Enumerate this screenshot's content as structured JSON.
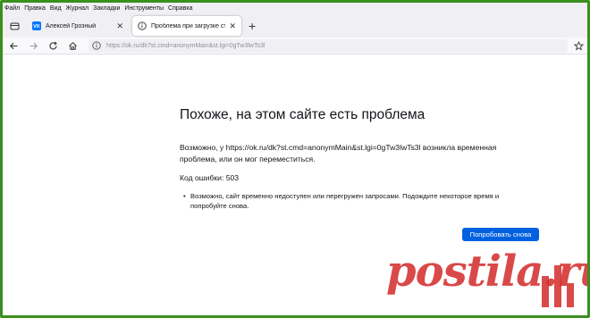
{
  "menubar": [
    "Файл",
    "Правка",
    "Вид",
    "Журнал",
    "Закладки",
    "Инструменты",
    "Справка"
  ],
  "tabs": [
    {
      "title": "Алексей Грозный",
      "favicon": "vk-icon"
    },
    {
      "title": "Проблема при загрузке стра…",
      "favicon": "info-icon"
    }
  ],
  "toolbar": {
    "url_host": "https://ok.ru",
    "url_path": "/dk?st.cmd=anonymMain&st.lgi=0gTw3lwTs3l"
  },
  "error": {
    "title": "Похоже, на этом сайте есть проблема",
    "description": "Возможно, у https://ok.ru/dk?st.cmd=anonymMain&st.lgi=0gTw3lwTs3l возникла временная проблема, или он мог переместиться.",
    "code": "Код ошибки: 503",
    "bullets": [
      "Возможно, сайт временно недоступен или перегружен запросами. Подождите некоторое время и попробуйте снова."
    ],
    "retry_label": "Попробовать снова"
  },
  "watermark": {
    "text": "postila.ru",
    "color": "#d42a2a"
  },
  "colors": {
    "frame": "#3a8f1f",
    "accent": "#0061e0"
  }
}
